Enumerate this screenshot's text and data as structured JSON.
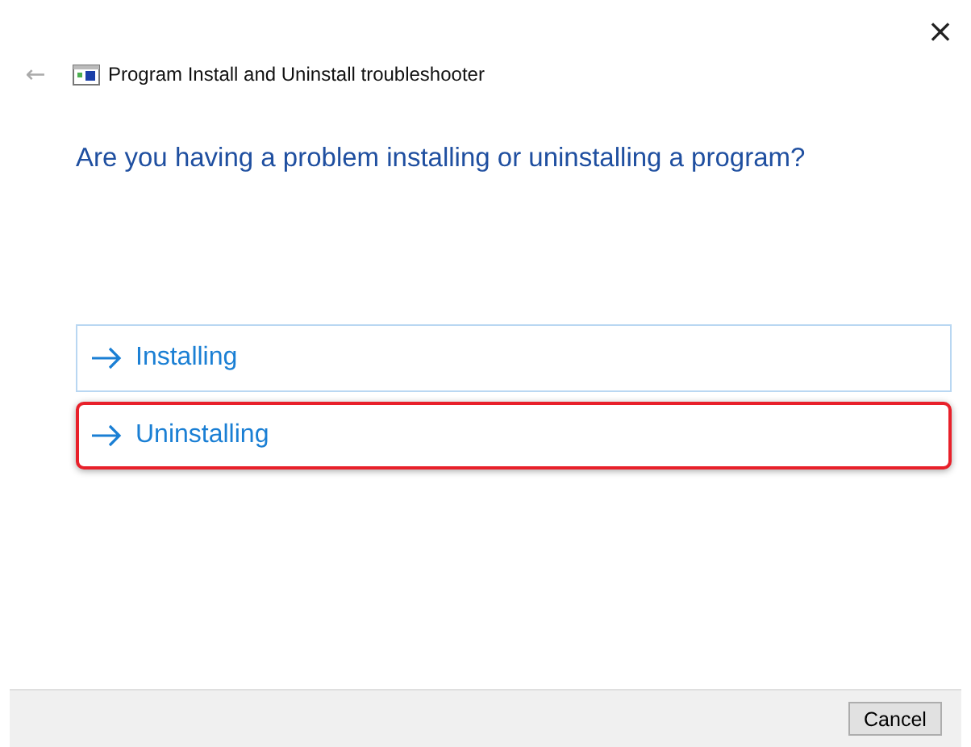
{
  "window": {
    "close": "×"
  },
  "header": {
    "back": "←",
    "title": "Program Install and Uninstall troubleshooter"
  },
  "question": "Are you having a problem installing or uninstalling a program?",
  "options": [
    {
      "label": "Installing",
      "hovered": true,
      "highlighted": false
    },
    {
      "label": "Uninstalling",
      "hovered": false,
      "highlighted": true
    }
  ],
  "buttons": [
    "Cancel"
  ]
}
